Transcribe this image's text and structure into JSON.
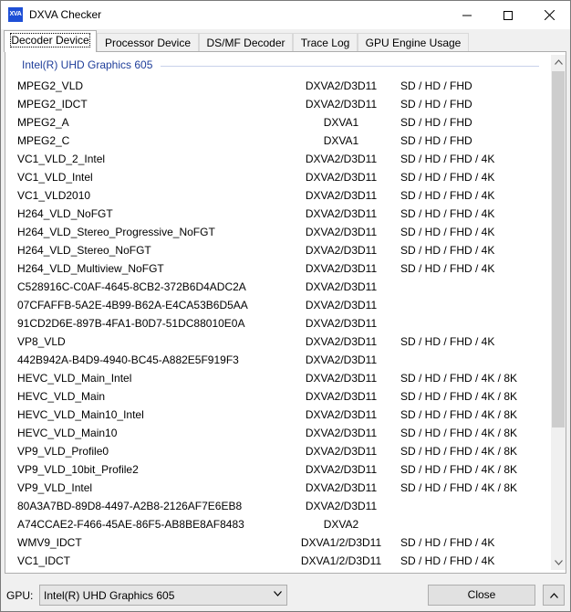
{
  "window": {
    "title": "DXVA Checker",
    "app_icon_text": "XVA"
  },
  "tabs": [
    {
      "label": "Decoder Device",
      "active": true
    },
    {
      "label": "Processor Device",
      "active": false
    },
    {
      "label": "DS/MF Decoder",
      "active": false
    },
    {
      "label": "Trace Log",
      "active": false
    },
    {
      "label": "GPU Engine Usage",
      "active": false
    }
  ],
  "list": {
    "group_title": "Intel(R) UHD Graphics 605",
    "rows": [
      {
        "name": "MPEG2_VLD",
        "api": "DXVA2/D3D11",
        "res": "SD / HD / FHD"
      },
      {
        "name": "MPEG2_IDCT",
        "api": "DXVA2/D3D11",
        "res": "SD / HD / FHD"
      },
      {
        "name": "MPEG2_A",
        "api": "DXVA1",
        "res": "SD / HD / FHD"
      },
      {
        "name": "MPEG2_C",
        "api": "DXVA1",
        "res": "SD / HD / FHD"
      },
      {
        "name": "VC1_VLD_2_Intel",
        "api": "DXVA2/D3D11",
        "res": "SD / HD / FHD / 4K"
      },
      {
        "name": "VC1_VLD_Intel",
        "api": "DXVA2/D3D11",
        "res": "SD / HD / FHD / 4K"
      },
      {
        "name": "VC1_VLD2010",
        "api": "DXVA2/D3D11",
        "res": "SD / HD / FHD / 4K"
      },
      {
        "name": "H264_VLD_NoFGT",
        "api": "DXVA2/D3D11",
        "res": "SD / HD / FHD / 4K"
      },
      {
        "name": "H264_VLD_Stereo_Progressive_NoFGT",
        "api": "DXVA2/D3D11",
        "res": "SD / HD / FHD / 4K"
      },
      {
        "name": "H264_VLD_Stereo_NoFGT",
        "api": "DXVA2/D3D11",
        "res": "SD / HD / FHD / 4K"
      },
      {
        "name": "H264_VLD_Multiview_NoFGT",
        "api": "DXVA2/D3D11",
        "res": "SD / HD / FHD / 4K"
      },
      {
        "name": "C528916C-C0AF-4645-8CB2-372B6D4ADC2A",
        "api": "DXVA2/D3D11",
        "res": ""
      },
      {
        "name": "07CFAFFB-5A2E-4B99-B62A-E4CA53B6D5AA",
        "api": "DXVA2/D3D11",
        "res": ""
      },
      {
        "name": "91CD2D6E-897B-4FA1-B0D7-51DC88010E0A",
        "api": "DXVA2/D3D11",
        "res": ""
      },
      {
        "name": "VP8_VLD",
        "api": "DXVA2/D3D11",
        "res": "SD / HD / FHD / 4K"
      },
      {
        "name": "442B942A-B4D9-4940-BC45-A882E5F919F3",
        "api": "DXVA2/D3D11",
        "res": ""
      },
      {
        "name": "HEVC_VLD_Main_Intel",
        "api": "DXVA2/D3D11",
        "res": "SD / HD / FHD / 4K / 8K"
      },
      {
        "name": "HEVC_VLD_Main",
        "api": "DXVA2/D3D11",
        "res": "SD / HD / FHD / 4K / 8K"
      },
      {
        "name": "HEVC_VLD_Main10_Intel",
        "api": "DXVA2/D3D11",
        "res": "SD / HD / FHD / 4K / 8K"
      },
      {
        "name": "HEVC_VLD_Main10",
        "api": "DXVA2/D3D11",
        "res": "SD / HD / FHD / 4K / 8K"
      },
      {
        "name": "VP9_VLD_Profile0",
        "api": "DXVA2/D3D11",
        "res": "SD / HD / FHD / 4K / 8K"
      },
      {
        "name": "VP9_VLD_10bit_Profile2",
        "api": "DXVA2/D3D11",
        "res": "SD / HD / FHD / 4K / 8K"
      },
      {
        "name": "VP9_VLD_Intel",
        "api": "DXVA2/D3D11",
        "res": "SD / HD / FHD / 4K / 8K"
      },
      {
        "name": "80A3A7BD-89D8-4497-A2B8-2126AF7E6EB8",
        "api": "DXVA2/D3D11",
        "res": ""
      },
      {
        "name": "A74CCAE2-F466-45AE-86F5-AB8BE8AF8483",
        "api": "DXVA2",
        "res": ""
      },
      {
        "name": "WMV9_IDCT",
        "api": "DXVA1/2/D3D11",
        "res": "SD / HD / FHD / 4K"
      },
      {
        "name": "VC1_IDCT",
        "api": "DXVA1/2/D3D11",
        "res": "SD / HD / FHD / 4K"
      }
    ]
  },
  "bottom": {
    "gpu_label": "GPU:",
    "gpu_value": "Intel(R) UHD Graphics 605",
    "close_label": "Close"
  },
  "icons": {
    "minimize": "minimize-icon",
    "maximize": "maximize-icon",
    "close": "close-icon",
    "scroll_up": "scroll-up-arrow-icon",
    "scroll_down": "scroll-down-arrow-icon",
    "dropdown": "chevron-down-icon",
    "more": "chevron-up-icon"
  }
}
